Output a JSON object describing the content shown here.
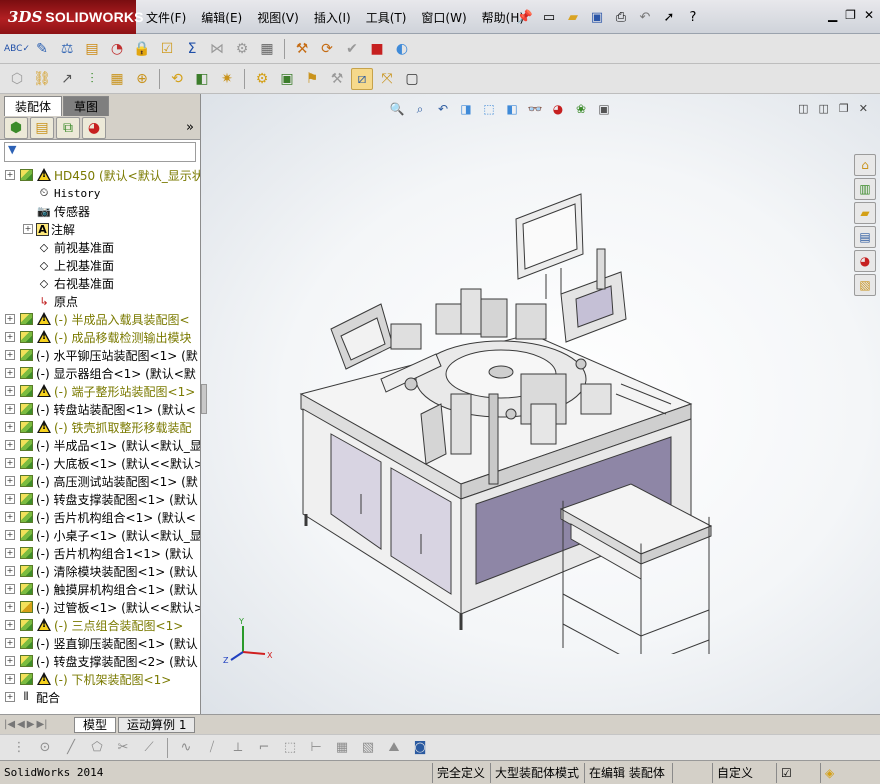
{
  "app": {
    "brand_prefix": "3DS",
    "brand": "SOLIDWORKS"
  },
  "menu": [
    "文件(F)",
    "编辑(E)",
    "视图(V)",
    "插入(I)",
    "工具(T)",
    "窗口(W)",
    "帮助(H)"
  ],
  "left_tabs": {
    "tab1": "装配体",
    "tab2": "草图"
  },
  "tree": [
    {
      "label": "HD450  (默认<默认_显示状态",
      "icon": "assembly-warning",
      "expand": "+",
      "root": true,
      "warn": true
    },
    {
      "label": "History",
      "icon": "history",
      "expand": "",
      "indent": 1,
      "mono": true
    },
    {
      "label": "传感器",
      "icon": "sensor",
      "expand": "",
      "indent": 1
    },
    {
      "label": "注解",
      "icon": "annotation",
      "expand": "+",
      "indent": 1
    },
    {
      "label": "前视基准面",
      "icon": "plane",
      "expand": "",
      "indent": 1
    },
    {
      "label": "上视基准面",
      "icon": "plane",
      "expand": "",
      "indent": 1
    },
    {
      "label": "右视基准面",
      "icon": "plane",
      "expand": "",
      "indent": 1
    },
    {
      "label": "原点",
      "icon": "origin",
      "expand": "",
      "indent": 1
    },
    {
      "label": "(-) 半成品入载具装配图<",
      "icon": "assembly-warning",
      "expand": "+",
      "warn": true
    },
    {
      "label": "(-) 成品移载检测输出模块",
      "icon": "assembly-warning",
      "expand": "+",
      "warn": true
    },
    {
      "label": "(-) 水平铆压站装配图<1> (默",
      "icon": "assembly",
      "expand": "+"
    },
    {
      "label": "(-) 显示器组合<1> (默认<默",
      "icon": "assembly",
      "expand": "+"
    },
    {
      "label": "(-) 端子整形站装配图<1>",
      "icon": "assembly-warning",
      "expand": "+",
      "warn": true
    },
    {
      "label": "(-) 转盘站装配图<1> (默认<",
      "icon": "assembly",
      "expand": "+"
    },
    {
      "label": "(-) 铁壳抓取整形移载装配",
      "icon": "assembly-warning",
      "expand": "+",
      "warn": true
    },
    {
      "label": "(-) 半成品<1> (默认<默认_显",
      "icon": "assembly",
      "expand": "+"
    },
    {
      "label": "(-) 大底板<1> (默认<<默认>",
      "icon": "assembly",
      "expand": "+"
    },
    {
      "label": "(-) 高压测试站装配图<1> (默",
      "icon": "assembly",
      "expand": "+"
    },
    {
      "label": "(-) 转盘支撑装配图<1> (默认",
      "icon": "assembly",
      "expand": "+"
    },
    {
      "label": "(-) 舌片机构组合<1> (默认<",
      "icon": "assembly",
      "expand": "+"
    },
    {
      "label": "(-) 小桌子<1> (默认<默认_显",
      "icon": "assembly",
      "expand": "+"
    },
    {
      "label": "(-) 舌片机构组合1<1> (默认",
      "icon": "assembly",
      "expand": "+"
    },
    {
      "label": "(-) 清除模块装配图<1> (默认",
      "icon": "assembly",
      "expand": "+"
    },
    {
      "label": "(-) 触摸屏机构组合<1> (默认",
      "icon": "assembly",
      "expand": "+"
    },
    {
      "label": "(-) 过管板<1> (默认<<默认>",
      "icon": "part",
      "expand": "+"
    },
    {
      "label": "(-) 三点组合装配图<1>",
      "icon": "assembly-warning",
      "expand": "+",
      "warn": true
    },
    {
      "label": "(-) 竖直铆压装配图<1> (默认",
      "icon": "assembly",
      "expand": "+"
    },
    {
      "label": "(-) 转盘支撑装配图<2> (默认",
      "icon": "assembly",
      "expand": "+"
    },
    {
      "label": "(-) 下机架装配图<1>",
      "icon": "assembly-warning",
      "expand": "+",
      "warn": true
    },
    {
      "label": "配合",
      "icon": "mates",
      "expand": "+"
    }
  ],
  "bottom_tabs": {
    "tab1": "模型",
    "tab2": "运动算例 1"
  },
  "status": {
    "app": "SolidWorks 2014",
    "definition": "完全定义",
    "mode": "大型装配体模式",
    "editing": "在编辑 装配体",
    "units": "自定义"
  },
  "colors": {
    "brand_red": "#b21f22",
    "warn_yellow": "#f1c40f",
    "tree_warn_text": "#7a7a00"
  }
}
